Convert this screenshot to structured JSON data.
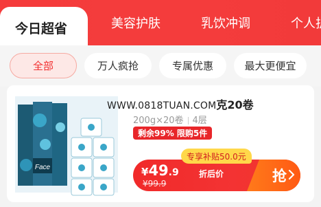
{
  "tabs": [
    {
      "label": "今日超省"
    },
    {
      "label": "美容护肤"
    },
    {
      "label": "乳饮冲调"
    },
    {
      "label": "个人护"
    }
  ],
  "filters": [
    {
      "label": "全部"
    },
    {
      "label": "万人疯抢"
    },
    {
      "label": "专属优惠"
    },
    {
      "label": "最大更便宜"
    }
  ],
  "product": {
    "watermark": "WWW.0818TUAN.COM",
    "title_tail": "克20卷",
    "spec_weight": "200g×20卷",
    "spec_layers": "4层",
    "stock_badge": "剩余99% 限购5件",
    "subsidy": "专享补贴50.0元",
    "currency": "¥",
    "price_int": "49",
    "price_dec": ".9",
    "price_label": "折后价",
    "old_price": "¥99.9",
    "buy_label": "抢",
    "image_brand": "Face"
  },
  "colors": {
    "brand_red": "#f23a3a",
    "accent_orange": "#ff6a18",
    "subsidy_yellow": "#ffd84a"
  }
}
